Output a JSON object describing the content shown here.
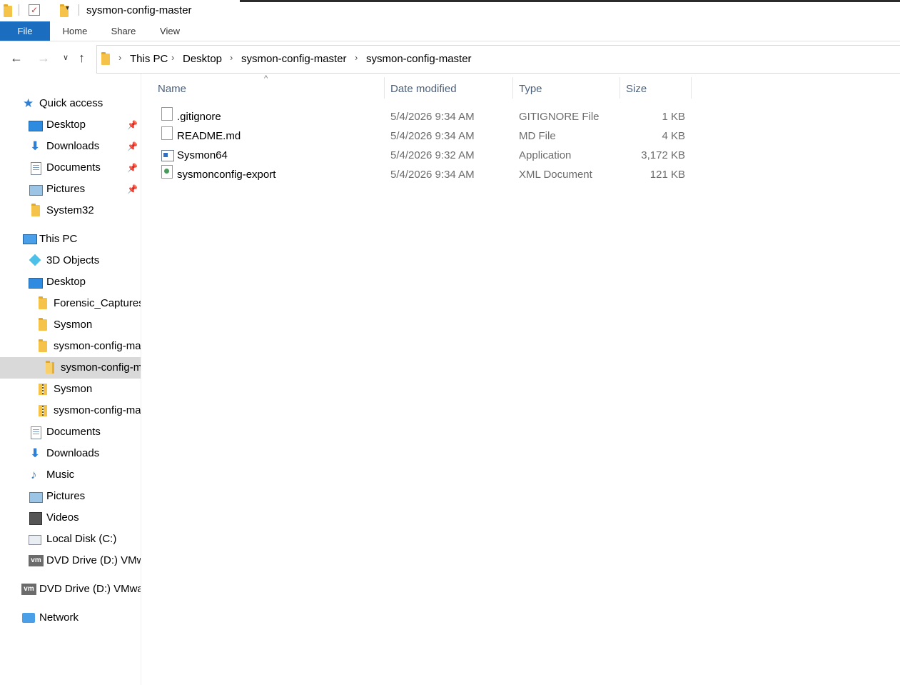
{
  "window": {
    "title": "sysmon-config-master"
  },
  "ribbon": {
    "tabs": [
      "File",
      "Home",
      "Share",
      "View"
    ]
  },
  "address_bar": {
    "crumbs": [
      "This PC",
      "Desktop",
      "sysmon-config-master",
      "sysmon-config-master"
    ]
  },
  "nav_pane": {
    "items": [
      {
        "label": "Quick access",
        "icon": "star-icon"
      },
      {
        "label": "Desktop",
        "icon": "desktop-icon",
        "pinned": true
      },
      {
        "label": "Downloads",
        "icon": "downloads-icon",
        "pinned": true
      },
      {
        "label": "Documents",
        "icon": "documents-icon",
        "pinned": true
      },
      {
        "label": "Pictures",
        "icon": "pictures-icon",
        "pinned": true
      },
      {
        "label": "System32",
        "icon": "folder-icon"
      },
      {
        "label": "This PC",
        "icon": "pc-icon"
      },
      {
        "label": "3D Objects",
        "icon": "3d-objects-icon"
      },
      {
        "label": "Desktop",
        "icon": "desktop-icon"
      },
      {
        "label": "Forensic_Captures",
        "icon": "folder-icon"
      },
      {
        "label": "Sysmon",
        "icon": "folder-icon"
      },
      {
        "label": "sysmon-config-master",
        "icon": "folder-icon"
      },
      {
        "label": "sysmon-config-master",
        "icon": "folder-open-icon",
        "selected": true
      },
      {
        "label": "Sysmon",
        "icon": "zip-folder-icon"
      },
      {
        "label": "sysmon-config-master",
        "icon": "zip-folder-icon"
      },
      {
        "label": "Documents",
        "icon": "documents-icon"
      },
      {
        "label": "Downloads",
        "icon": "downloads-icon"
      },
      {
        "label": "Music",
        "icon": "music-icon"
      },
      {
        "label": "Pictures",
        "icon": "pictures-icon"
      },
      {
        "label": "Videos",
        "icon": "videos-icon"
      },
      {
        "label": "Local Disk (C:)",
        "icon": "disk-icon"
      },
      {
        "label": "DVD Drive (D:) VMware Tools",
        "icon": "vmware-icon"
      },
      {
        "label": "DVD Drive (D:) VMware Tools",
        "icon": "vmware-icon"
      },
      {
        "label": "Network",
        "icon": "network-icon"
      }
    ],
    "pin_glyph": "📌"
  },
  "file_list": {
    "columns": [
      "Name",
      "Date modified",
      "Type",
      "Size"
    ],
    "rows": [
      {
        "name": ".gitignore",
        "date": "5/4/2026 9:34 AM",
        "type": "GITIGNORE File",
        "size": "1 KB",
        "icon": "file-icon"
      },
      {
        "name": "README.md",
        "date": "5/4/2026 9:34 AM",
        "type": "MD File",
        "size": "4 KB",
        "icon": "file-icon"
      },
      {
        "name": "Sysmon64",
        "date": "5/4/2026 9:32 AM",
        "type": "Application",
        "size": "3,172 KB",
        "icon": "application-icon"
      },
      {
        "name": "sysmonconfig-export",
        "date": "5/4/2026 9:34 AM",
        "type": "XML Document",
        "size": "121 KB",
        "icon": "xml-document-icon"
      }
    ]
  },
  "colors": {
    "file_tab": "#1a6dbf",
    "selection": "#d9d9d9",
    "header_text": "#4c607a",
    "secondary_text": "#6d6d6d"
  }
}
